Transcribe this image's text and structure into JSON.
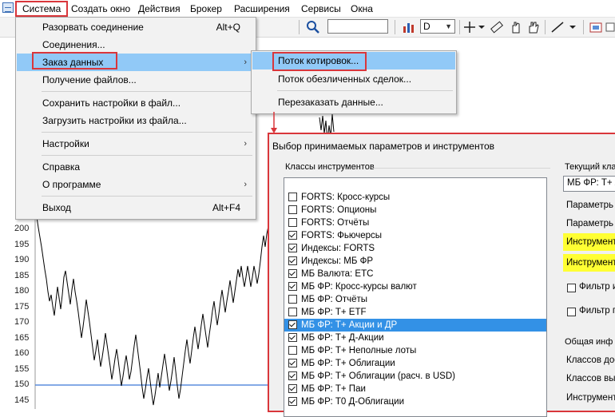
{
  "menubar": {
    "items": [
      "Система",
      "Создать окно",
      "Действия",
      "Брокер",
      "Расширения",
      "Сервисы",
      "Окна"
    ]
  },
  "toolbar": {
    "interval_value": "D"
  },
  "chart": {
    "y_ticks": [
      "200",
      "195",
      "190",
      "185",
      "180",
      "175",
      "170",
      "165",
      "160",
      "155",
      "150",
      "145"
    ],
    "line_color": "#000000",
    "level_color": "#3b78d8"
  },
  "system_menu": {
    "items": [
      {
        "label": "Разорвать соединение",
        "shortcut": "Alt+Q"
      },
      {
        "label": "Соединения..."
      },
      {
        "label": "Заказ данных",
        "submenu": "›"
      },
      {
        "label": "Получение файлов..."
      },
      {
        "label": "Сохранить настройки в файл..."
      },
      {
        "label": "Загрузить настройки из файла..."
      },
      {
        "label": "Настройки",
        "submenu": "›"
      },
      {
        "label": "Справка"
      },
      {
        "label": "О программе",
        "submenu": "›"
      },
      {
        "label": "Выход",
        "shortcut": "Alt+F4"
      }
    ]
  },
  "data_submenu": {
    "items": [
      "Поток котировок...",
      "Поток обезличенных сделок...",
      "Перезаказать данные..."
    ]
  },
  "dialog": {
    "title": "Выбор принимаемых параметров и инструментов",
    "classes_group": "Классы инструментов",
    "classes": [
      {
        "label": "FORTS: Кросс-курсы",
        "checked": false
      },
      {
        "label": "FORTS: Опционы",
        "checked": false
      },
      {
        "label": "FORTS: Отчёты",
        "checked": false
      },
      {
        "label": "FORTS: Фьючерсы",
        "checked": true
      },
      {
        "label": "Индексы: FORTS",
        "checked": true
      },
      {
        "label": "Индексы: МБ ФР",
        "checked": true
      },
      {
        "label": "МБ Валюта: ETC",
        "checked": true
      },
      {
        "label": "МБ ФР: Кросс-курсы валют",
        "checked": true
      },
      {
        "label": "МБ ФР: Отчёты",
        "checked": false
      },
      {
        "label": "МБ ФР: Т+ ETF",
        "checked": false
      },
      {
        "label": "МБ ФР: Т+ Акции и ДР",
        "checked": true,
        "selected": true
      },
      {
        "label": "МБ ФР: Т+ Д-Акции",
        "checked": true
      },
      {
        "label": "МБ ФР: Т+ Неполные лоты",
        "checked": false
      },
      {
        "label": "МБ ФР: Т+ Облигации",
        "checked": true
      },
      {
        "label": "МБ ФР: Т+ Облигации (расч. в USD)",
        "checked": true
      },
      {
        "label": "МБ ФР: Т+ Паи",
        "checked": true
      },
      {
        "label": "МБ ФР: Т0 Д-Облигации",
        "checked": true
      }
    ],
    "right": {
      "current_group": "Текущий кла",
      "current_value": "МБ ФР: Т+ А",
      "param1": "Параметрь",
      "param2": "Параметрь",
      "instr1": "Инструмент",
      "instr2": "Инструмент",
      "filter1": "Фильтр и",
      "filter2": "Фильтр п",
      "general_group": "Общая инф",
      "classes_avail": "Классов дос",
      "classes_sel": "Классов выб",
      "instruments": "Инструмент"
    }
  }
}
